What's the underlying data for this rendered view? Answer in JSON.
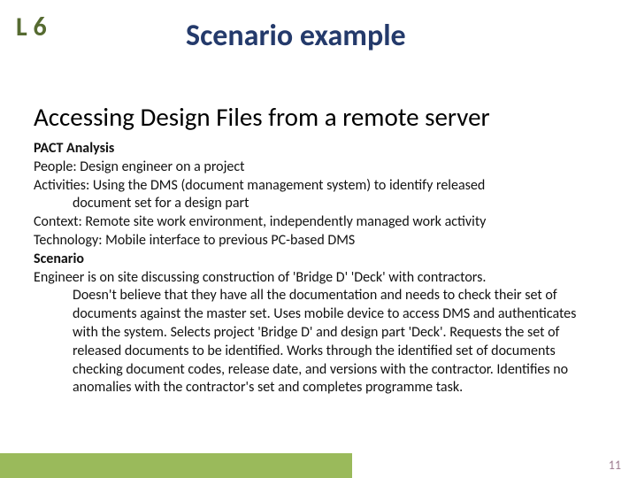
{
  "badge": "L 6",
  "title": "Scenario example",
  "subtitle": "Accessing Design Files from a remote server",
  "pact_heading": "PACT Analysis",
  "people": "People: Design engineer on a project",
  "activities_line1": "Activities: Using the DMS (document management system) to identify released",
  "activities_line2": "document set for a design part",
  "context": "Context: Remote site work environment, independently managed work activity",
  "technology": "Technology: Mobile interface to previous PC-based DMS",
  "scenario_heading": "Scenario",
  "scenario_line1": "Engineer is on site discussing construction of 'Bridge D' 'Deck' with contractors.",
  "scenario_line2": "Doesn't believe that they have all the documentation and needs to check their set of documents against the master set. Uses mobile device to access DMS and authenticates with the system. Selects project 'Bridge D' and design part 'Deck'. Requests the set of released documents to be identified. Works through the identified set of documents checking document codes, release date, and versions with the contractor. Identifies no anomalies with the contractor's set and completes programme task.",
  "page_number": "11"
}
